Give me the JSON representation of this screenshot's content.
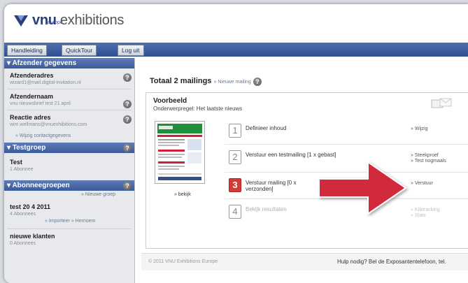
{
  "brand": {
    "name_bold": "vnu",
    "name_rest": " exhibitions",
    "sub": "europe"
  },
  "topbar": {
    "buttons": [
      "Handleiding",
      "QuickTour",
      "Log uit"
    ]
  },
  "sidebar": {
    "afzender": {
      "heading": "Afzender gegevens",
      "entries": [
        {
          "title": "Afzenderadres",
          "sub": "wizard1@mail.digital-invitation.nl"
        },
        {
          "title": "Afzendernaam",
          "sub": "vnu nieuwsbrief test 21 april"
        },
        {
          "title": "Reactie adres",
          "sub": "wim.wellmans@vnuexhibitions.com"
        }
      ],
      "link": "» Wijzig contactgegevens"
    },
    "testgroep": {
      "heading": "Testgroep",
      "entry": {
        "title": "Test",
        "sub": "1 Abonnee"
      }
    },
    "abonnee": {
      "heading": "Abonneegroepen",
      "link_new": "» Nieuwe groep",
      "entries": [
        {
          "title": "test 20 4 2011",
          "sub": "4 Abonnees",
          "links": "» Importeer » Hernoem"
        },
        {
          "title": "nieuwe klanten",
          "sub": "0 Abonnees"
        }
      ]
    }
  },
  "main": {
    "totaal": "Totaal 2 mailings",
    "new_link": "» Nieuwe mailing",
    "voorbeeld": {
      "title": "Voorbeeld",
      "subject": "Onderwerpregel: Het laatste nieuws"
    },
    "thumb_link": "» bekijk",
    "steps": [
      {
        "num": "1",
        "text": "Definieer inhoud",
        "action": "» Wijzig"
      },
      {
        "num": "2",
        "text": "Verstuur een testmailing [1 x gebast]",
        "action": "» Steekproef\n» Test nogmaals"
      },
      {
        "num": "3",
        "text": "Verstuur mailing [0 x verzonden]",
        "action": "» Verstuur"
      },
      {
        "num": "4",
        "text": "Bekijk resultaten",
        "action": "» Kliktracking\n» Stats"
      }
    ],
    "footer_left": "© 2011 VNU Exhibitions Europe",
    "footer_right": "Hulp nodig? Bel de Exposantentelefoon, tel."
  },
  "colors": {
    "accent": "#3b5a98",
    "arrow": "#d22a3c",
    "step_active": "#d33a3a"
  }
}
